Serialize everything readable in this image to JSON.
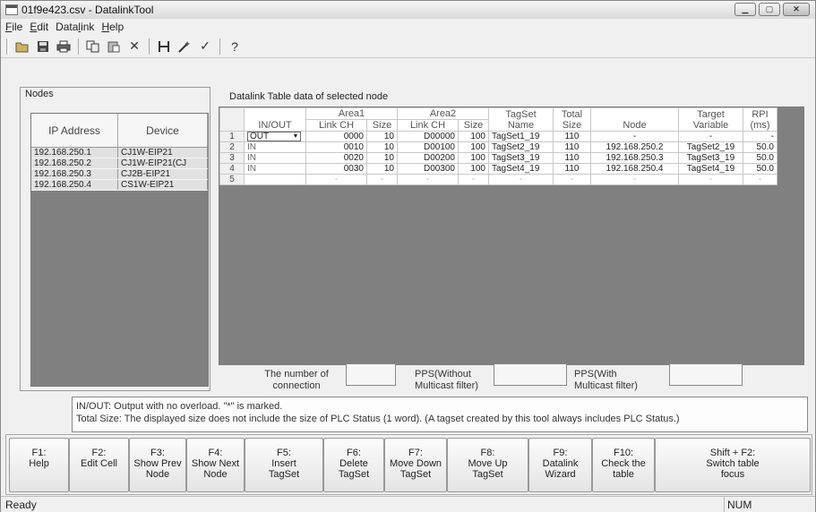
{
  "window": {
    "title": "01f9e423.csv - DatalinkTool"
  },
  "menu": [
    "File",
    "Edit",
    "Datalink",
    "Help"
  ],
  "menu_underline": [
    "F",
    "E",
    "l",
    "H"
  ],
  "toolbar_icons": [
    "open-icon",
    "save-icon",
    "print-icon",
    "copy-icon",
    "paste-icon",
    "delete-icon",
    "cut-column-icon",
    "wizard-icon",
    "check-icon",
    "help-icon"
  ],
  "nodes": {
    "label": "Nodes",
    "headers": [
      "IP Address",
      "Device"
    ],
    "rows": [
      [
        "192.168.250.1",
        "CJ1W-EIP21"
      ],
      [
        "192.168.250.2",
        "CJ1W-EIP21(CJ"
      ],
      [
        "192.168.250.3",
        "CJ2B-EIP21"
      ],
      [
        "192.168.250.4",
        "CS1W-EIP21"
      ]
    ]
  },
  "datalink": {
    "label": "Datalink Table data of selected node",
    "group_headers": {
      "area1": "Area1",
      "area2": "Area2"
    },
    "headers": {
      "inout": "IN/OUT",
      "link_ch1": "Link CH",
      "size1": "Size",
      "link_ch2": "Link CH",
      "size2": "Size",
      "tagset_name": "TagSet Name",
      "total_size": "Total Size",
      "node": "Node",
      "target_variable": "Target Variable",
      "rpi": "RPI (ms)"
    },
    "rows": [
      {
        "num": "1",
        "inout": "OUT",
        "link_ch1": "0000",
        "size1": "10",
        "link_ch2": "D00000",
        "size2": "100",
        "tagset": "TagSet1_19",
        "total": "110",
        "node": "-",
        "target": "-",
        "rpi": "-"
      },
      {
        "num": "2",
        "inout": "IN",
        "link_ch1": "0010",
        "size1": "10",
        "link_ch2": "D00100",
        "size2": "100",
        "tagset": "TagSet2_19",
        "total": "110",
        "node": "192.168.250.2",
        "target": "TagSet2_19",
        "rpi": "50.0"
      },
      {
        "num": "3",
        "inout": "IN",
        "link_ch1": "0020",
        "size1": "10",
        "link_ch2": "D00200",
        "size2": "100",
        "tagset": "TagSet3_19",
        "total": "110",
        "node": "192.168.250.3",
        "target": "TagSet3_19",
        "rpi": "50.0"
      },
      {
        "num": "4",
        "inout": "IN",
        "link_ch1": "0030",
        "size1": "10",
        "link_ch2": "D00300",
        "size2": "100",
        "tagset": "TagSet4_19",
        "total": "110",
        "node": "192.168.250.4",
        "target": "TagSet4_19",
        "rpi": "50.0"
      },
      {
        "num": "5",
        "inout": "",
        "link_ch1": "-",
        "size1": "-",
        "link_ch2": "-",
        "size2": "-",
        "tagset": "-",
        "total": "-",
        "node": "-",
        "target": "-",
        "rpi": "-"
      }
    ]
  },
  "stats": {
    "connections_label": "The number of connection",
    "connections_value": "",
    "pps_without_label": "PPS(Without Multicast filter)",
    "pps_without_value": "",
    "pps_with_label": "PPS(With Multicast filter)",
    "pps_with_value": ""
  },
  "note": {
    "line1": "IN/OUT: Output with no overload. \"*\" is marked.",
    "line2": "Total Size: The displayed size does not include the size of PLC Status (1 word). (A tagset created by this tool always includes PLC Status.)"
  },
  "fkeys": [
    {
      "label": "F1:\nHelp"
    },
    {
      "label": "F2:\nEdit Cell"
    },
    {
      "label": "F3:\nShow Prev\nNode"
    },
    {
      "label": "F4:\nShow Next\nNode"
    },
    {
      "label": "F5:\nInsert\nTagSet"
    },
    {
      "label": "F6:\nDelete\nTagSet"
    },
    {
      "label": "F7:\nMove Down\nTagSet"
    },
    {
      "label": "F8:\nMove Up\nTagSet"
    },
    {
      "label": "F9:\nDatalink\nWizard"
    },
    {
      "label": "F10:\nCheck the\ntable"
    },
    {
      "label": "Shift + F2:\nSwitch table\nfocus"
    }
  ],
  "status": {
    "text": "Ready",
    "num": "NUM"
  }
}
